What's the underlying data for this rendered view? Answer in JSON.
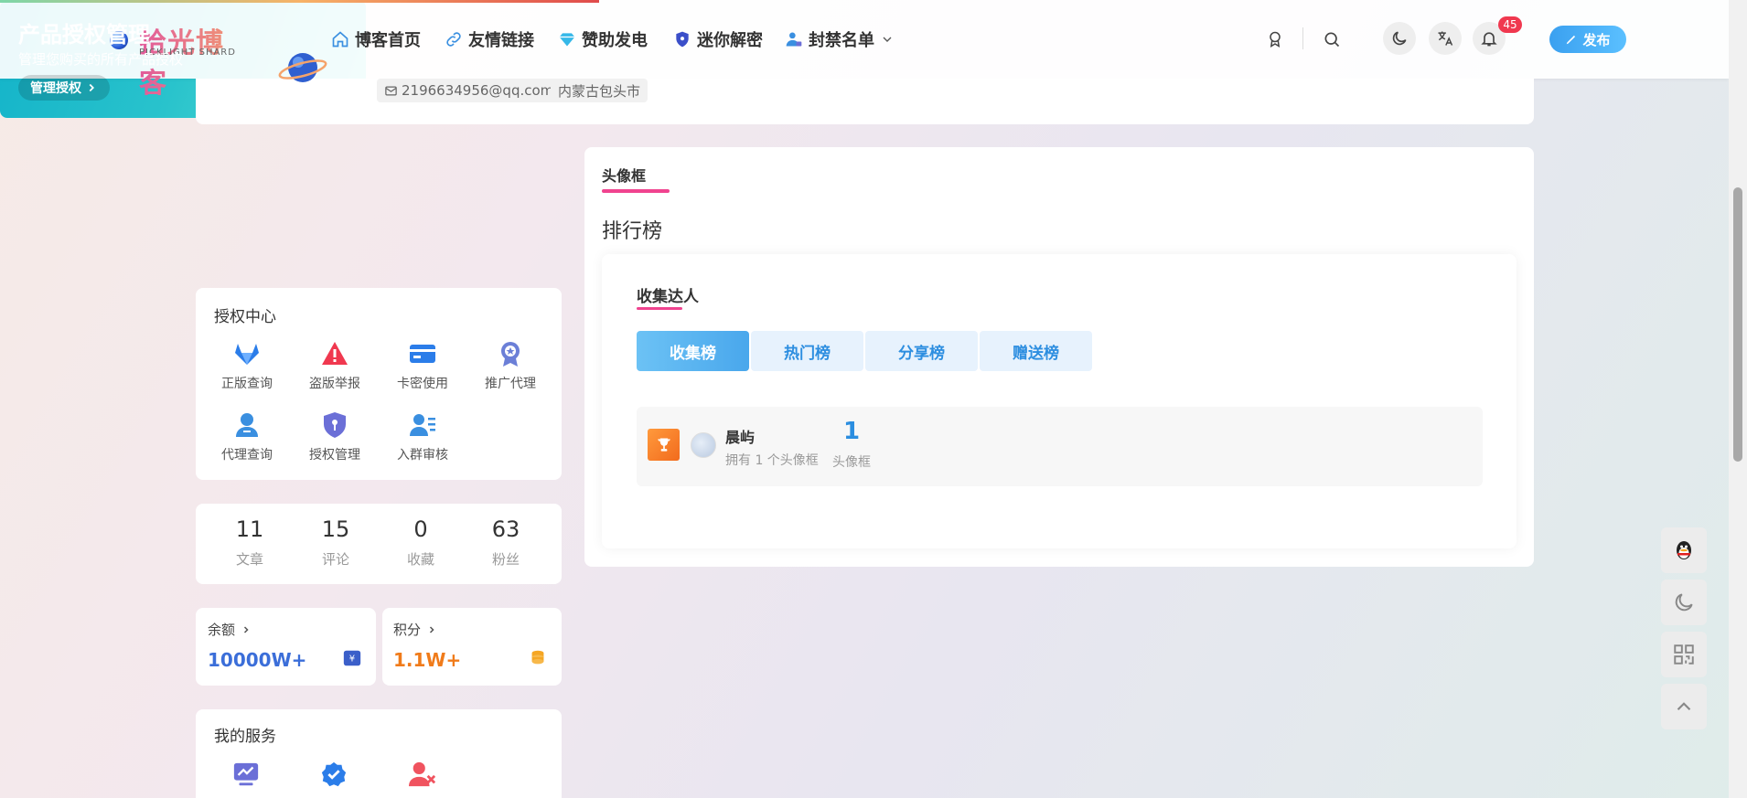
{
  "header": {
    "logo_title": "拾光博客",
    "logo_subtitle": "PICKLIGHT SHARD",
    "nav": [
      {
        "label": "博客首页",
        "icon": "home-icon"
      },
      {
        "label": "友情链接",
        "icon": "link-icon"
      },
      {
        "label": "赞助发电",
        "icon": "diamond-icon"
      },
      {
        "label": "迷你解密",
        "icon": "shield-icon"
      },
      {
        "label": "封禁名单",
        "icon": "user-lock-icon"
      }
    ],
    "notification_count": "45",
    "publish_label": "发布"
  },
  "profile": {
    "email": "2196634956@qq.com",
    "location": "内蒙古包头市"
  },
  "promo": {
    "title": "产品授权管理",
    "subtitle": "管理您购买的所有产品授权",
    "button": "管理授权"
  },
  "auth_center": {
    "title": "授权中心",
    "items": [
      {
        "label": "正版查询",
        "icon": "gitlab-icon",
        "color": "#2b7de9"
      },
      {
        "label": "盗版举报",
        "icon": "warning-icon",
        "color": "#f0384f"
      },
      {
        "label": "卡密使用",
        "icon": "card-icon",
        "color": "#2b7de9"
      },
      {
        "label": "推广代理",
        "icon": "award-icon",
        "color": "#6b7fd7"
      },
      {
        "label": "代理查询",
        "icon": "user-icon",
        "color": "#3a8fe0"
      },
      {
        "label": "授权管理",
        "icon": "shield-key-icon",
        "color": "#6b6fd7"
      },
      {
        "label": "入群审核",
        "icon": "user-list-icon",
        "color": "#3a8fe0"
      }
    ]
  },
  "stats": [
    {
      "value": "11",
      "label": "文章"
    },
    {
      "value": "15",
      "label": "评论"
    },
    {
      "value": "0",
      "label": "收藏"
    },
    {
      "value": "63",
      "label": "粉丝"
    }
  ],
  "wallet": {
    "balance_label": "余额",
    "balance_value": "10000W+",
    "points_label": "积分",
    "points_value": "1.1W+",
    "balance_color": "#3b6ed9",
    "points_color": "#f07b1a"
  },
  "services": {
    "title": "我的服务"
  },
  "main": {
    "tab_label": "头像框",
    "ranking_title": "排行榜",
    "inner_tab": "收集达人",
    "tabs": [
      "收集榜",
      "热门榜",
      "分享榜",
      "赠送榜"
    ],
    "entries": [
      {
        "name": "晨屿",
        "desc": "拥有 1 个头像框",
        "count": "1",
        "unit": "头像框"
      }
    ]
  },
  "accent": "#f0438f"
}
